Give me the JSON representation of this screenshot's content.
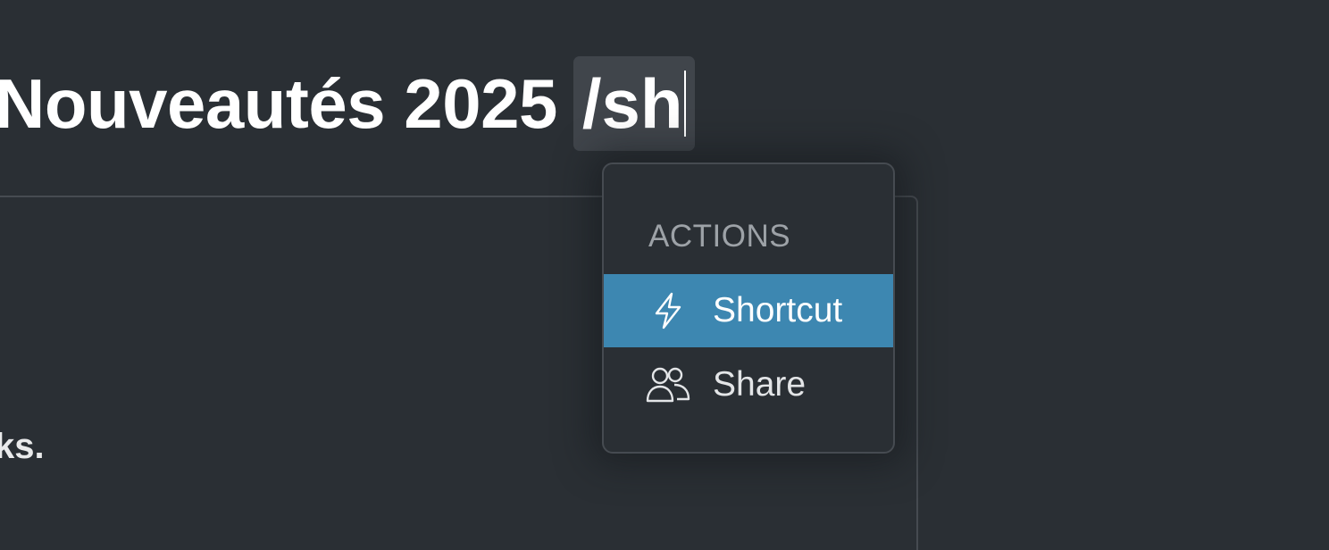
{
  "editor": {
    "title": "Nouveautés 2025",
    "command_input": "/sh",
    "body_fragment": "ks."
  },
  "command_menu": {
    "heading": "ACTIONS",
    "items": [
      {
        "label": "Shortcut",
        "icon": "lightning-bolt-icon",
        "selected": true
      },
      {
        "label": "Share",
        "icon": "users-icon",
        "selected": false
      }
    ]
  },
  "colors": {
    "background": "#2a2f34",
    "selected_item": "#3d87b1",
    "chip_background": "#40454b",
    "border": "#464b51"
  }
}
